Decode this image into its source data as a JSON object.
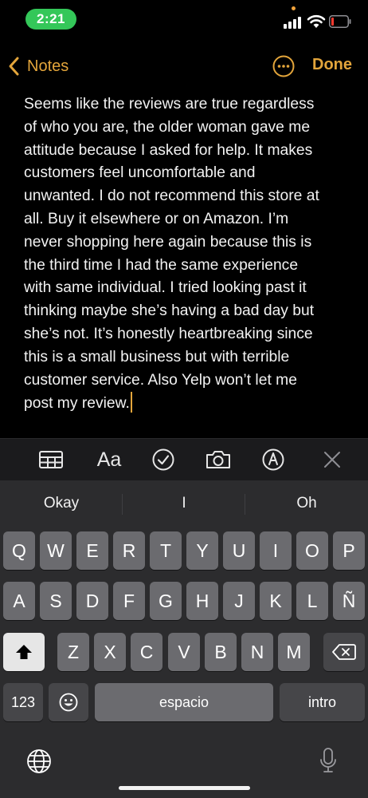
{
  "status_bar": {
    "time": "2:21"
  },
  "nav": {
    "back_label": "Notes",
    "done_label": "Done"
  },
  "note": {
    "lines": [
      "Seems like the reviews are true regardless",
      "of who you are, the older woman gave me",
      "attitude because I asked for help. It makes",
      "customers feel uncomfortable and",
      "unwanted. I do not recommend this store at",
      "all. Buy it elsewhere or on Amazon. I’m",
      "never shopping here again because this is",
      "the third time I had the same experience",
      "with same individual. I tried looking past it",
      "thinking maybe she’s having a bad day but",
      "she’s not. It’s honestly heartbreaking since",
      "this is a small business but with terrible",
      "customer service. Also Yelp won’t let me",
      "post my review."
    ]
  },
  "toolbar": {
    "format_label": "Aa"
  },
  "keyboard": {
    "suggestions": [
      "Okay",
      "I",
      "Oh"
    ],
    "row1": [
      "Q",
      "W",
      "E",
      "R",
      "T",
      "Y",
      "U",
      "I",
      "O",
      "P"
    ],
    "row2": [
      "A",
      "S",
      "D",
      "F",
      "G",
      "H",
      "J",
      "K",
      "L",
      "Ñ"
    ],
    "row3": [
      "Z",
      "X",
      "C",
      "V",
      "B",
      "N",
      "M"
    ],
    "numbers_label": "123",
    "space_label": "espacio",
    "return_label": "intro"
  },
  "colors": {
    "accent": "#e3a53b",
    "time_pill": "#34c759",
    "key": "#6b6b6f",
    "key_dark": "#464649"
  }
}
